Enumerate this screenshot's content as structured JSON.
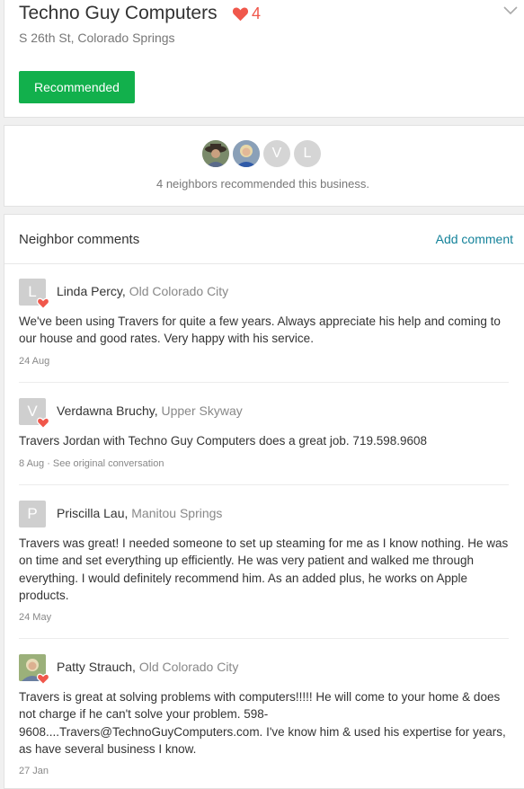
{
  "business": {
    "name": "Techno Guy Computers",
    "heart_count": "4",
    "address": "S 26th St, Colorado Springs",
    "recommended_label": "Recommended"
  },
  "recommenders": {
    "avatars": [
      {
        "type": "photo",
        "label": ""
      },
      {
        "type": "photo",
        "label": ""
      },
      {
        "type": "initial",
        "label": "V"
      },
      {
        "type": "initial",
        "label": "L"
      }
    ],
    "summary": "4 neighbors recommended this business."
  },
  "comments_section": {
    "title": "Neighbor comments",
    "add_comment_label": "Add comment",
    "comments": [
      {
        "initial": "L",
        "name": "Linda Percy",
        "neighborhood": "Old Colorado City",
        "text": "We've been using Travers for quite a few years. Always appreciate his help and coming to our house and good rates. Very happy with his service.",
        "date": "24 Aug",
        "hearted": true
      },
      {
        "initial": "V",
        "name": "Verdawna Bruchy",
        "neighborhood": "Upper Skyway",
        "text": "Travers Jordan with Techno Guy Computers does a great job. 719.598.9608",
        "date": "8 Aug · See original conversation",
        "hearted": true
      },
      {
        "initial": "P",
        "name": "Priscilla Lau",
        "neighborhood": "Manitou Springs",
        "text": "Travers was great! I needed someone to set up steaming for me as I know nothing. He was on time and set everything up efficiently. He was very patient and walked me through everything. I would definitely recommend him. As an added plus, he works on Apple products.",
        "date": "24 May",
        "hearted": false
      },
      {
        "initial": "",
        "name": "Patty Strauch",
        "neighborhood": "Old Colorado City",
        "text": "Travers is great at solving problems with computers!!!!! He will come to your home & does not charge if he can't solve your problem. 598-9608....Travers@TechnoGuyComputers.com. I've know him & used his expertise for years, as have several business I know.",
        "date": "27 Jan",
        "hearted": true
      }
    ]
  },
  "colors": {
    "accent_green": "#12b04c",
    "heart_red": "#f0574b",
    "link_teal": "#14829a"
  }
}
